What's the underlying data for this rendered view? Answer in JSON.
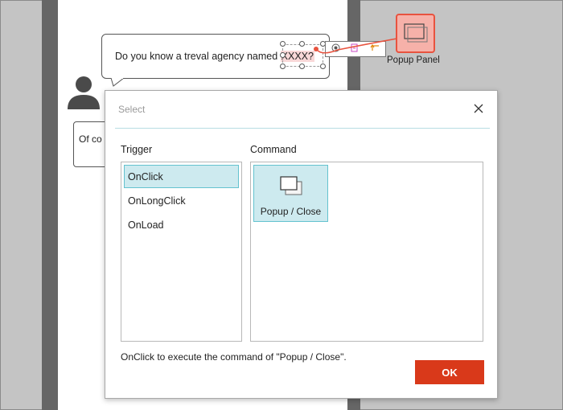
{
  "canvas": {
    "bubble_text_before": "Do you know a treval agency named ",
    "bubble_text_highlight": "XXXX?",
    "popup_panel_label": "Popup Panel",
    "partial_text": "Of co",
    "toolbar_icons": [
      "target-icon",
      "note-icon",
      "corner-arrow-icon"
    ]
  },
  "dialog": {
    "title": "Select",
    "trigger_label": "Trigger",
    "command_label": "Command",
    "triggers": [
      {
        "label": "OnClick",
        "selected": true
      },
      {
        "label": "OnLongClick",
        "selected": false
      },
      {
        "label": "OnLoad",
        "selected": false
      }
    ],
    "commands": [
      {
        "label": "Popup / Close",
        "icon": "popup-window-icon",
        "selected": true
      }
    ],
    "message": "OnClick to execute the command of \"Popup / Close\".",
    "ok_label": "OK"
  },
  "colors": {
    "accent": "#d9391a",
    "selection_fill": "#cdeaef",
    "selection_border": "#63c2cf",
    "link_line": "#e8533f"
  }
}
